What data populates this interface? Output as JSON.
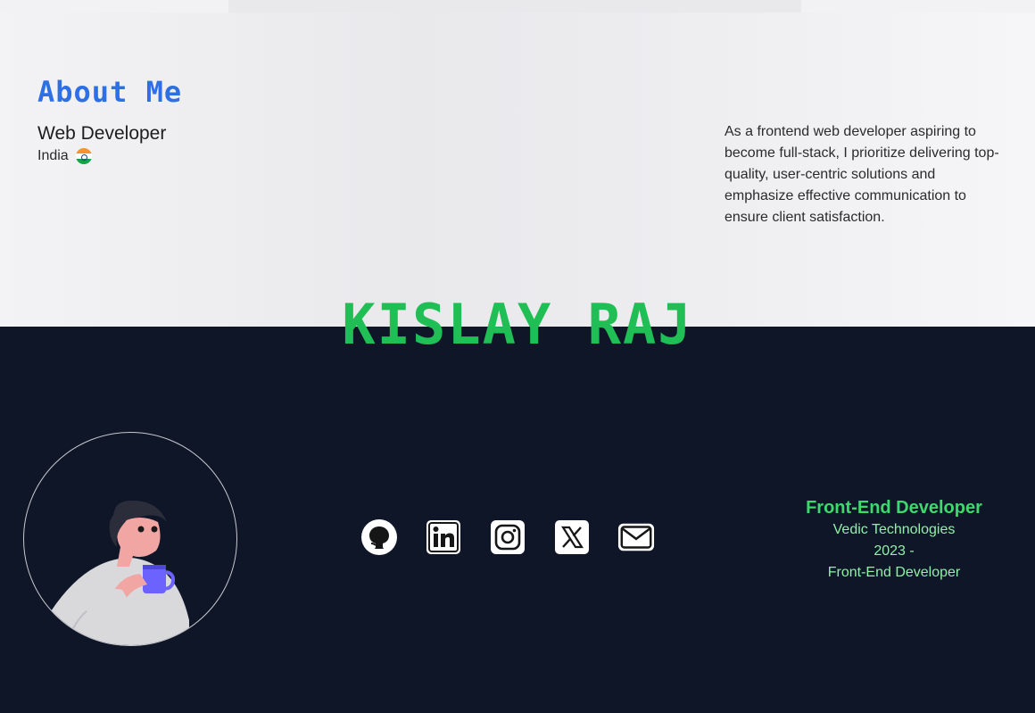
{
  "about": {
    "heading": "About Me",
    "role": "Web Developer",
    "country": "India",
    "description": "As a frontend web developer aspiring to become full-stack, I prioritize delivering top-quality, user-centric solutions and emphasize effective communication to ensure client satisfaction."
  },
  "hero": {
    "name": "KISLAY RAJ"
  },
  "socials": [
    {
      "icon": "github-icon"
    },
    {
      "icon": "linkedin-icon"
    },
    {
      "icon": "instagram-icon"
    },
    {
      "icon": "x-twitter-icon"
    },
    {
      "icon": "mail-icon"
    }
  ],
  "experience": {
    "title": "Front-End Developer",
    "company": "Vedic Technologies",
    "period": "2023 -",
    "position": "Front-End Developer"
  },
  "colors": {
    "accent_blue": "#2f6fe4",
    "name_green": "#1fbf55",
    "job_green": "#3ed96d",
    "dark_bg": "#0e1628"
  }
}
